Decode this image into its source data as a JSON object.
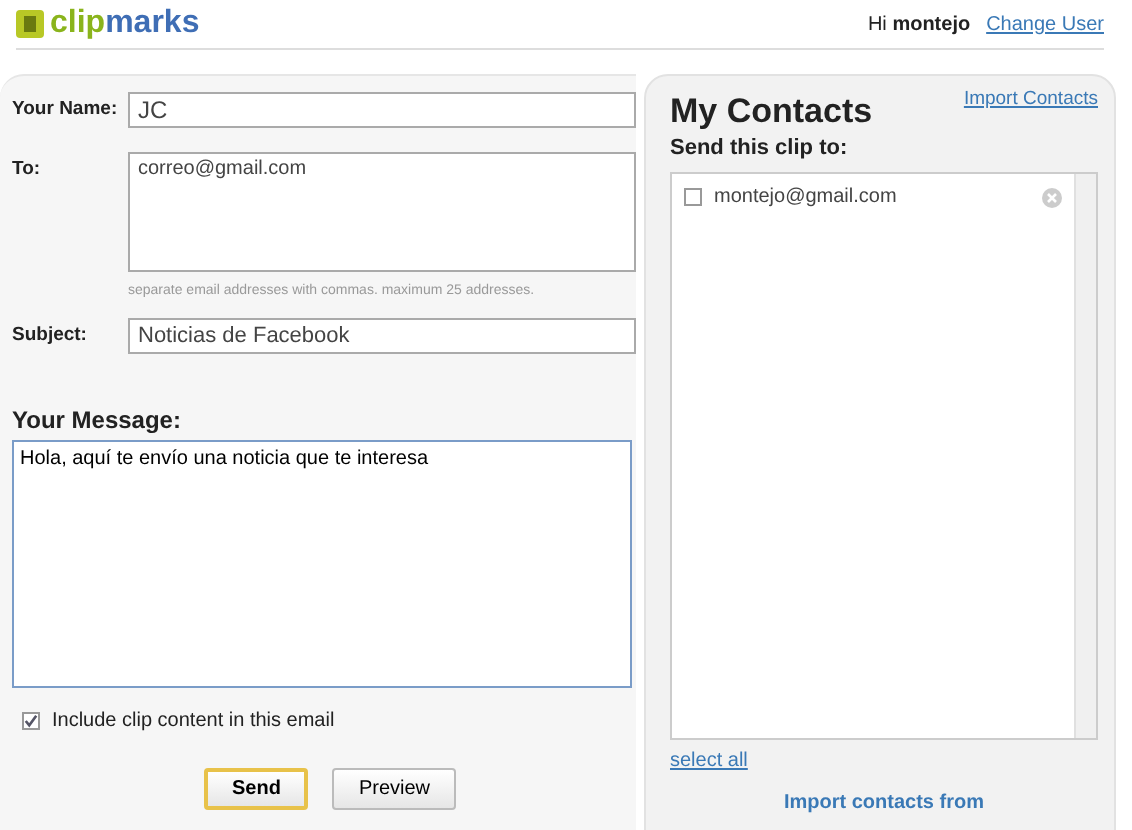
{
  "header": {
    "logo": {
      "part1": "clip",
      "part2": "marks"
    },
    "greeting": "Hi",
    "user": "montejo",
    "change_user": "Change User"
  },
  "form": {
    "name": {
      "label": "Your Name:",
      "value": "JC"
    },
    "to": {
      "label": "To:",
      "value": "correo@gmail.com",
      "hint": "separate email addresses with commas.  maximum 25 addresses."
    },
    "subject": {
      "label": "Subject:",
      "value": "Noticias de Facebook"
    },
    "message": {
      "label": "Your Message:",
      "value": "Hola, aquí te envío una noticia que te interesa"
    },
    "include_clip": {
      "label": "Include clip content in this email",
      "checked": true
    },
    "buttons": [
      {
        "label": "Send",
        "selected": true
      },
      {
        "label": "Preview",
        "selected": false
      }
    ]
  },
  "contacts": {
    "title": "My Contacts",
    "import_link": "Import Contacts",
    "subtitle": "Send this clip to:",
    "items": [
      {
        "email": "montejo@gmail.com",
        "checked": false
      }
    ],
    "select_all": "select all",
    "import_from": "Import contacts from"
  }
}
